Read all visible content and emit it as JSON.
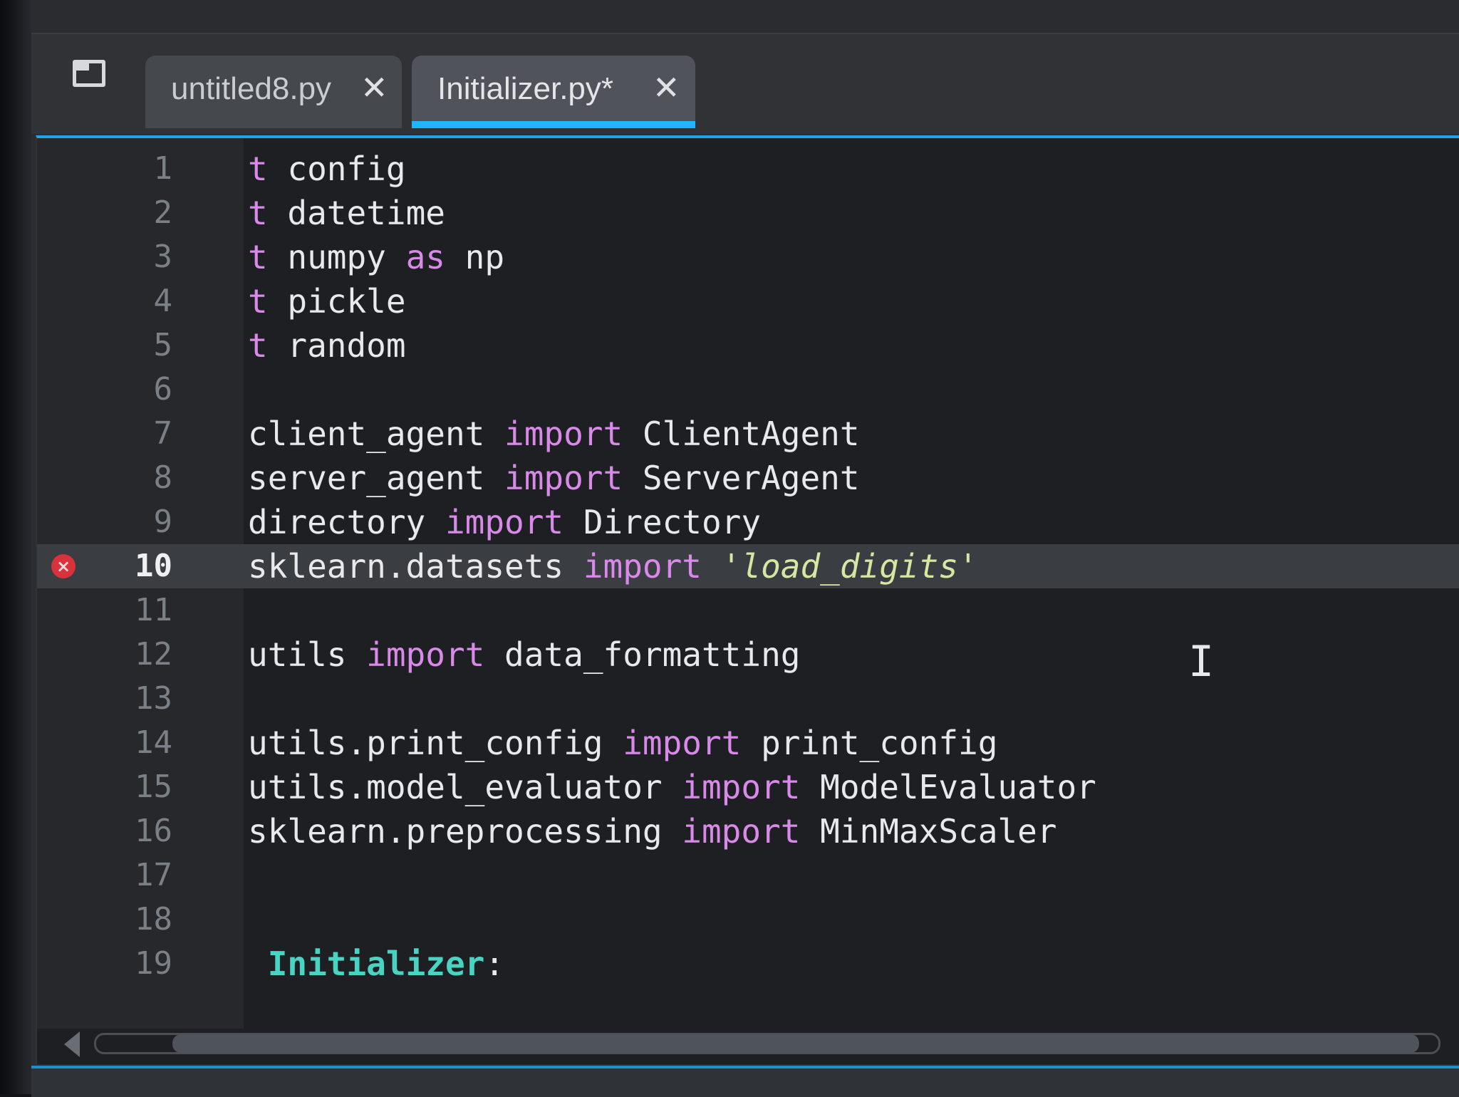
{
  "tabs": [
    {
      "label": "untitled8.py",
      "close": "✕"
    },
    {
      "label": "Initializer.py*",
      "close": "✕",
      "active": true
    }
  ],
  "icons": {
    "pane_toggle": "panel-toggle-icon",
    "error": "error-icon",
    "cursor": "text-cursor-icon"
  },
  "colors": {
    "keyword": "#d989e8",
    "string": "#d7e6a2",
    "class_name": "#49d3c2",
    "active_tab_accent": "#1fb6ff",
    "error": "#d8323c"
  },
  "editor": {
    "error_line": 10,
    "current_line": 10,
    "lines": [
      {
        "n": "1",
        "a": "t",
        "b": " config",
        "c": "",
        "d": "",
        "e": ""
      },
      {
        "n": "2",
        "a": "t",
        "b": " datetime",
        "c": "",
        "d": "",
        "e": ""
      },
      {
        "n": "3",
        "a": "t",
        "b": " numpy ",
        "c": "as",
        "d": " np",
        "e": ""
      },
      {
        "n": "4",
        "a": "t",
        "b": " pickle",
        "c": "",
        "d": "",
        "e": ""
      },
      {
        "n": "5",
        "a": "t",
        "b": " random",
        "c": "",
        "d": "",
        "e": ""
      },
      {
        "n": "6",
        "a": "",
        "b": "",
        "c": "",
        "d": "",
        "e": ""
      },
      {
        "n": "7",
        "a": "",
        "b": "client_agent ",
        "c": "import",
        "d": " ClientAgent",
        "e": ""
      },
      {
        "n": "8",
        "a": "",
        "b": "server_agent ",
        "c": "import",
        "d": " ServerAgent",
        "e": ""
      },
      {
        "n": "9",
        "a": "",
        "b": "directory ",
        "c": "import",
        "d": " Directory",
        "e": ""
      },
      {
        "n": "10",
        "a": "",
        "b": "sklearn.datasets ",
        "c": "import",
        "d": " ",
        "e": "'load_digits'"
      },
      {
        "n": "11",
        "a": "",
        "b": "",
        "c": "",
        "d": "",
        "e": ""
      },
      {
        "n": "12",
        "a": "",
        "b": "utils ",
        "c": "import",
        "d": " data_formatting",
        "e": ""
      },
      {
        "n": "13",
        "a": "",
        "b": "",
        "c": "",
        "d": "",
        "e": ""
      },
      {
        "n": "14",
        "a": "",
        "b": "utils.print_config ",
        "c": "import",
        "d": " print_config",
        "e": ""
      },
      {
        "n": "15",
        "a": "",
        "b": "utils.model_evaluator ",
        "c": "import",
        "d": " ModelEvaluator",
        "e": ""
      },
      {
        "n": "16",
        "a": "",
        "b": "sklearn.preprocessing ",
        "c": "import",
        "d": " MinMaxScaler",
        "e": ""
      },
      {
        "n": "17",
        "a": "",
        "b": "",
        "c": "",
        "d": "",
        "e": ""
      },
      {
        "n": "18",
        "a": "",
        "b": "",
        "c": "",
        "d": "",
        "e": ""
      },
      {
        "n": "19",
        "a": "",
        "b": "",
        "c": "",
        "d": "",
        "e": "",
        "cls": "Initializer",
        "colon": ":"
      }
    ]
  }
}
